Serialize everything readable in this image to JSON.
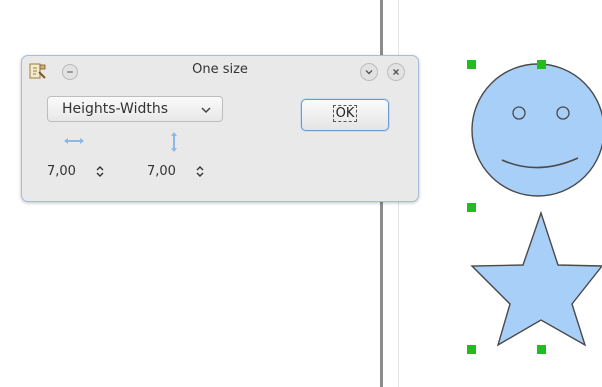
{
  "dialog": {
    "title": "One size",
    "mode_select": "Heights-Widths",
    "ok_label": "OK",
    "width_value": "7,00",
    "height_value": "7,00"
  },
  "icons": {
    "app": "app-icon",
    "minimize": "minimize-circle-icon",
    "shade": "chevron-down-icon",
    "close": "close-icon",
    "combo_arrow": "chevron-down-icon",
    "width": "horizontal-resize-icon",
    "height": "vertical-resize-icon",
    "spin": "spin-arrows-icon"
  },
  "colors": {
    "shape_fill": "#a8cff7",
    "handle": "#22bb22",
    "dialog_border": "#a4bedb",
    "ok_border": "#6c9ad0",
    "arrow_icon": "#8ab8e8"
  }
}
